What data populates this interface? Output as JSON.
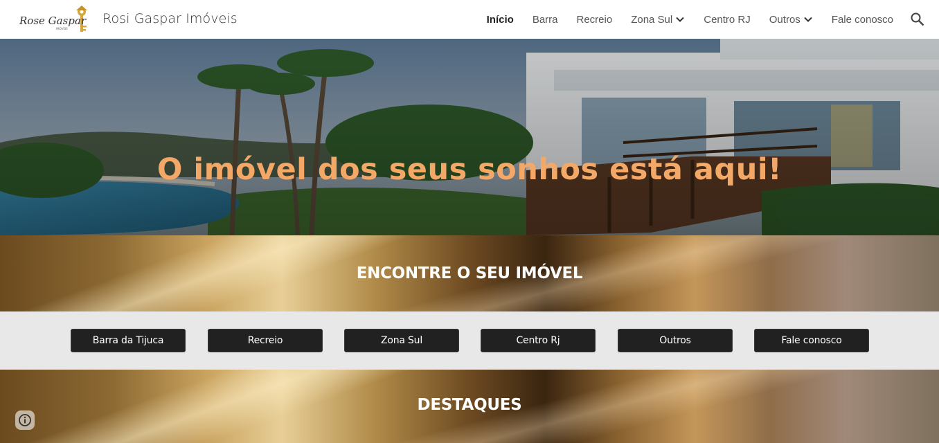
{
  "header": {
    "logo_text": "Rose Gaspar",
    "logo_subtext": "IMÓVEIS",
    "site_title": "Rosi Gaspar Imóveis"
  },
  "nav": {
    "items": [
      {
        "label": "Início",
        "active": true
      },
      {
        "label": "Barra"
      },
      {
        "label": "Recreio"
      },
      {
        "label": "Zona Sul",
        "dropdown": true
      },
      {
        "label": "Centro RJ"
      },
      {
        "label": "Outros",
        "dropdown": true
      },
      {
        "label": "Fale conosco"
      }
    ]
  },
  "hero": {
    "title": "O imóvel dos seus sonhos está aqui!"
  },
  "find_section": {
    "heading": "ENCONTRE O SEU IMÓVEL",
    "buttons": [
      "Barra da Tijuca",
      "Recreio",
      "Zona Sul",
      "Centro Rj",
      "Outros",
      "Fale conosco"
    ]
  },
  "highlights": {
    "heading": "DESTAQUES"
  },
  "icons": {
    "search": "search-icon",
    "dropdown": "chevron-down-icon",
    "info": "info-icon",
    "logo": "key-logo-icon"
  },
  "colors": {
    "hero_title": "#f4a867",
    "button_bg": "#212121",
    "button_row_bg": "#e8e8e8"
  }
}
